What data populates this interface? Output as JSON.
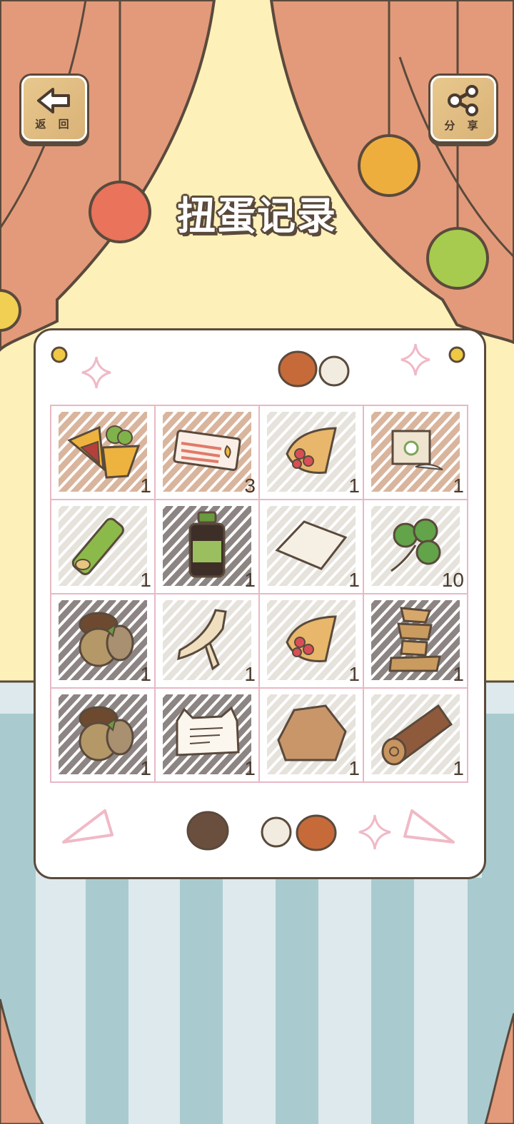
{
  "header": {
    "back_label": "返 回",
    "share_label": "分 享",
    "title": "扭蛋记录"
  },
  "items": [
    {
      "name": "omelette-icon",
      "count": "1",
      "hatch": "#d9b59d"
    },
    {
      "name": "bacon-ticket-icon",
      "count": "3",
      "hatch": "#d9b59d"
    },
    {
      "name": "strawberry-crepe-icon",
      "count": "1",
      "hatch": "#e6e2dc"
    },
    {
      "name": "tea-bag-icon",
      "count": "1",
      "hatch": "#d9b59d"
    },
    {
      "name": "bamboo-icon",
      "count": "1",
      "hatch": "#e6e2dc"
    },
    {
      "name": "medicine-bottle-icon",
      "count": "1",
      "hatch": "#8d8583"
    },
    {
      "name": "paper-sheet-icon",
      "count": "1",
      "hatch": "#e6e2dc"
    },
    {
      "name": "four-leaf-clover-icon",
      "count": "10",
      "hatch": "#e6e2dc"
    },
    {
      "name": "acorn-icon",
      "count": "1",
      "hatch": "#8d8583"
    },
    {
      "name": "dried-root-icon",
      "count": "1",
      "hatch": "#e6e2dc"
    },
    {
      "name": "strawberry-crepe-icon",
      "count": "1",
      "hatch": "#e6e2dc"
    },
    {
      "name": "stacked-stones-icon",
      "count": "1",
      "hatch": "#8d8583"
    },
    {
      "name": "acorn-icon",
      "count": "1",
      "hatch": "#8d8583"
    },
    {
      "name": "cat-letter-icon",
      "count": "1",
      "hatch": "#8d8583"
    },
    {
      "name": "rock-icon",
      "count": "1",
      "hatch": "#e6e2dc"
    },
    {
      "name": "log-icon",
      "count": "1",
      "hatch": "#e6e2dc"
    }
  ],
  "colors": {
    "curtain": "#e39a7a",
    "outline": "#5a4a3c",
    "grid_border": "#e7b9c3",
    "wall": "#fdf0b8",
    "floor_light": "#dde9ec",
    "floor_stripe": "#a9cbcf"
  }
}
